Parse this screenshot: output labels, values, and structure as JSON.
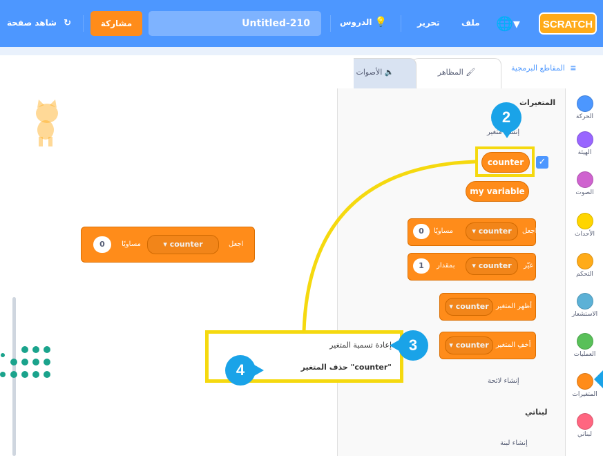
{
  "topbar": {
    "logo": "SCRATCH",
    "file": "ملف",
    "edit": "تحرير",
    "tutorials": "الدروس",
    "project_title": "Untitled-210",
    "share": "مشاركة",
    "see_page": "شاهد صفحة"
  },
  "tabs": {
    "code": "المقاطع البرمجية",
    "costumes": "المظاهر",
    "sounds": "الأصوات"
  },
  "categories": [
    {
      "label": "الحركة",
      "color": "#4c97ff"
    },
    {
      "label": "الهيئة",
      "color": "#9966ff"
    },
    {
      "label": "الصوت",
      "color": "#cf63cf"
    },
    {
      "label": "الأحداث",
      "color": "#ffd500"
    },
    {
      "label": "التحكم",
      "color": "#ffab19"
    },
    {
      "label": "الاستشعار",
      "color": "#5cb1d6"
    },
    {
      "label": "العمليات",
      "color": "#59c059"
    },
    {
      "label": "المتغيرات",
      "color": "#ff8c1a"
    },
    {
      "label": "لبناتي",
      "color": "#ff6680"
    }
  ],
  "palette": {
    "section_variables": "المتغيرات",
    "make_variable": "إنشاء متغير",
    "var_counter": "counter",
    "var_my_variable": "my variable",
    "set_word": "اجعل",
    "equals_word": "مساويًا",
    "set_value": "0",
    "change_word": "غيّر",
    "by_word": "بمقدار",
    "change_value": "1",
    "show_word": "أظهر المتغير",
    "hide_word": "أخفِ المتغير",
    "make_list": "إنشاء لائحة",
    "section_myblocks": "لبناتي",
    "make_block": "إنشاء لبنة"
  },
  "workspace_block": {
    "set_word": "اجعل",
    "var": "counter",
    "equals_word": "مساويًا",
    "value": "0"
  },
  "context_menu": {
    "rename": "إعادة تسمية المتغير",
    "delete": "حذف المتغير \"counter\""
  },
  "badges": {
    "b2": "2",
    "b3": "3",
    "b4": "4"
  },
  "colors": {
    "topbar": "#4d97ff",
    "variables": "#ff8c1a",
    "highlight": "#f5d90f",
    "badge": "#1aa3e8"
  }
}
